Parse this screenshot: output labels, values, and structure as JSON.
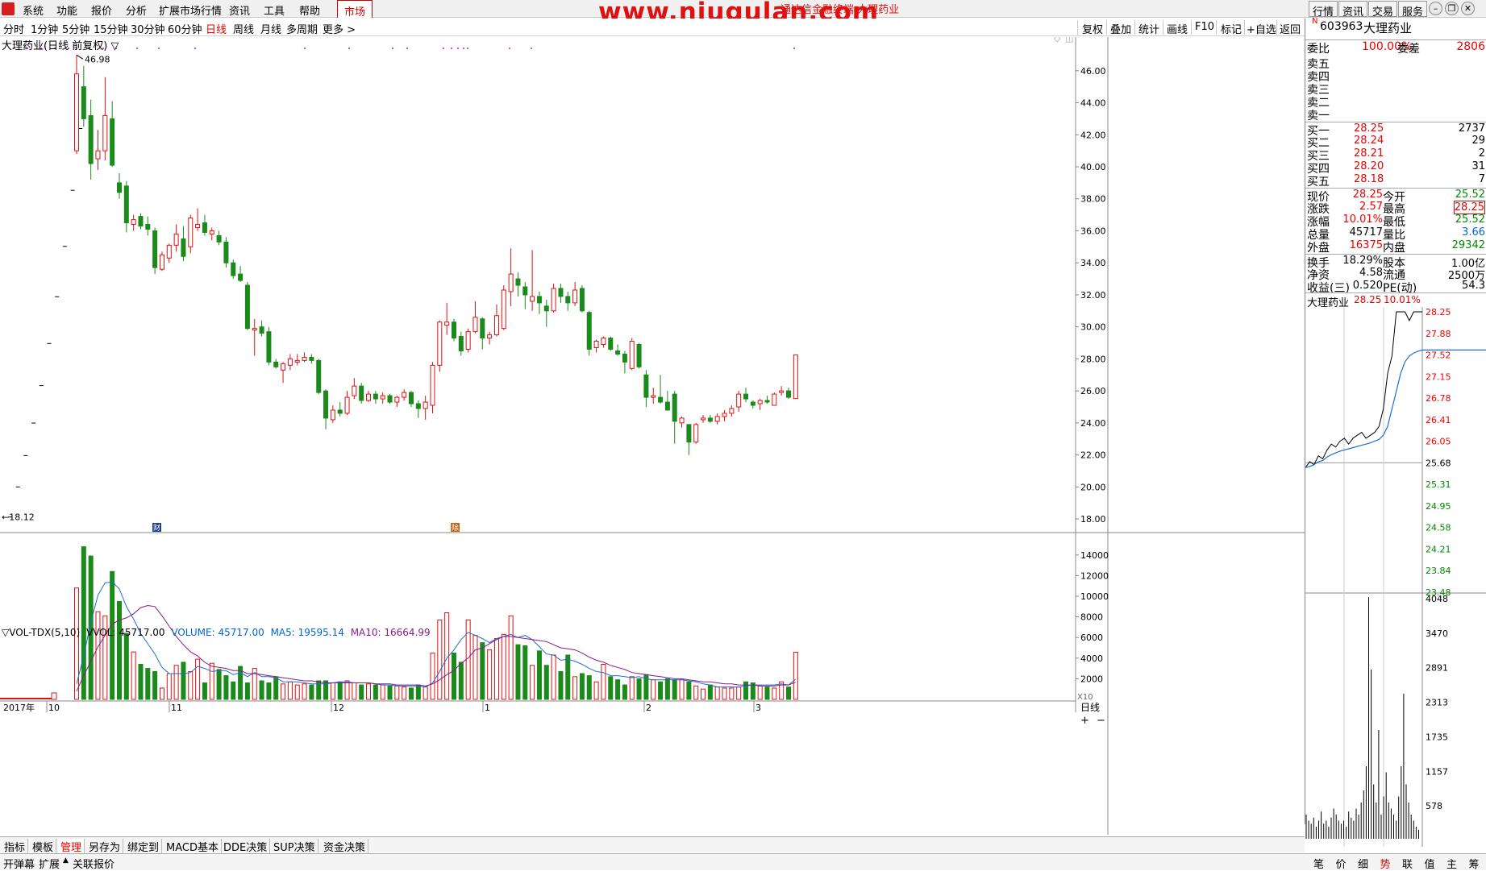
{
  "menu": {
    "items": [
      "系统",
      "功能",
      "报价",
      "分析",
      "扩展市场行情",
      "资讯",
      "工具",
      "帮助"
    ],
    "market": "市场",
    "watermark": "www.niugulan.com",
    "watermark_sub": "通达信金融终端 大理药业",
    "right_buttons": [
      "行情",
      "资讯",
      "交易",
      "服务"
    ]
  },
  "toolbar": {
    "periods": [
      "分时",
      "1分钟",
      "5分钟",
      "15分钟",
      "30分钟",
      "60分钟",
      "日线",
      "周线",
      "月线",
      "多周期",
      "更多 >"
    ],
    "active_period": "日线",
    "tools": [
      "复权",
      "叠加",
      "统计",
      "画线",
      "F10",
      "标记",
      "+自选",
      "返回"
    ]
  },
  "chart": {
    "title": "大理药业(日线 前复权) ▽",
    "high_marker": "46.98",
    "low_marker": "←18.12",
    "price_axis": [
      "46.00",
      "44.00",
      "42.00",
      "40.00",
      "38.00",
      "36.00",
      "34.00",
      "32.00",
      "30.00",
      "28.00",
      "26.00",
      "24.00",
      "22.00",
      "20.00",
      "18.00"
    ],
    "vol_axis": [
      "14000",
      "12000",
      "10000",
      "8000",
      "6000",
      "4000",
      "2000"
    ],
    "vol_unit": "X10",
    "date_labels": [
      "2017年",
      "10",
      "11",
      "12",
      "1",
      "2",
      "3"
    ],
    "period_label": "日线",
    "event_markers": [
      "财",
      "除"
    ],
    "vol_legend": {
      "name": "▽VOL-TDX(5,10)",
      "vvol": "VVOL: 45717.00",
      "volume": "VOLUME: 45717.00",
      "ma5": "MA5: 19595.14",
      "ma10": "MA10: 16664.99"
    },
    "colors": {
      "up": "#e01010",
      "down": "#1a8a1a",
      "ma5": "#1a6fd0",
      "ma10": "#8a1a8a",
      "dot": "#e000e0"
    }
  },
  "chart_data": {
    "type": "candlestick",
    "title": "大理药业(日线 前复权)",
    "ylim": [
      17.5,
      47.5
    ],
    "vol_ylim": [
      0,
      15000
    ],
    "ticks_before": [
      {
        "date": "9-a",
        "price": 18.12
      },
      {
        "date": "9-b",
        "price": 20.0
      },
      {
        "date": "9-c",
        "price": 21.96
      },
      {
        "date": "9-d",
        "price": 23.99
      },
      {
        "date": "9-e",
        "price": 26.33
      },
      {
        "date": "9-f",
        "price": 28.96
      },
      {
        "date": "9-g",
        "price": 31.88
      },
      {
        "date": "9-h",
        "price": 35.03
      },
      {
        "date": "9-i",
        "price": 38.53
      },
      {
        "date": "9-j",
        "price": 42.39
      }
    ],
    "candles": [
      {
        "o": 41.0,
        "h": 46.98,
        "l": 40.8,
        "c": 45.8
      },
      {
        "o": 45.0,
        "h": 46.3,
        "l": 42.5,
        "c": 43.0
      },
      {
        "o": 43.2,
        "h": 44.2,
        "l": 39.2,
        "c": 40.2
      },
      {
        "o": 40.5,
        "h": 42.3,
        "l": 39.8,
        "c": 41.0
      },
      {
        "o": 41.0,
        "h": 45.6,
        "l": 40.4,
        "c": 43.2
      },
      {
        "o": 43.0,
        "h": 44.1,
        "l": 40.0,
        "c": 40.1
      },
      {
        "o": 39.0,
        "h": 39.6,
        "l": 38.0,
        "c": 38.4
      },
      {
        "o": 38.8,
        "h": 39.1,
        "l": 35.9,
        "c": 36.5
      },
      {
        "o": 36.4,
        "h": 37.0,
        "l": 36.0,
        "c": 36.7
      },
      {
        "o": 36.9,
        "h": 37.1,
        "l": 36.1,
        "c": 36.3
      },
      {
        "o": 36.4,
        "h": 36.9,
        "l": 35.7,
        "c": 36.1
      },
      {
        "o": 36.0,
        "h": 36.2,
        "l": 33.3,
        "c": 33.7
      },
      {
        "o": 33.6,
        "h": 34.7,
        "l": 33.5,
        "c": 34.5
      },
      {
        "o": 34.3,
        "h": 35.2,
        "l": 34.0,
        "c": 35.1
      },
      {
        "o": 35.1,
        "h": 36.4,
        "l": 34.7,
        "c": 35.8
      },
      {
        "o": 35.5,
        "h": 36.3,
        "l": 34.1,
        "c": 34.4
      },
      {
        "o": 35.0,
        "h": 37.0,
        "l": 34.6,
        "c": 36.8
      },
      {
        "o": 36.2,
        "h": 37.4,
        "l": 36.0,
        "c": 36.4
      },
      {
        "o": 36.5,
        "h": 37.0,
        "l": 35.7,
        "c": 35.9
      },
      {
        "o": 35.8,
        "h": 36.2,
        "l": 35.4,
        "c": 36.0
      },
      {
        "o": 35.7,
        "h": 36.0,
        "l": 35.1,
        "c": 35.3
      },
      {
        "o": 35.3,
        "h": 35.6,
        "l": 33.7,
        "c": 34.0
      },
      {
        "o": 34.0,
        "h": 34.2,
        "l": 33.0,
        "c": 33.2
      },
      {
        "o": 33.3,
        "h": 33.8,
        "l": 32.8,
        "c": 32.9
      },
      {
        "o": 32.6,
        "h": 32.8,
        "l": 29.8,
        "c": 29.9
      },
      {
        "o": 29.8,
        "h": 30.5,
        "l": 28.2,
        "c": 29.9
      },
      {
        "o": 30.0,
        "h": 30.4,
        "l": 29.4,
        "c": 29.6
      },
      {
        "o": 29.7,
        "h": 30.0,
        "l": 27.6,
        "c": 27.8
      },
      {
        "o": 27.8,
        "h": 28.0,
        "l": 27.4,
        "c": 27.5
      },
      {
        "o": 27.3,
        "h": 27.8,
        "l": 26.5,
        "c": 27.7
      },
      {
        "o": 27.6,
        "h": 28.3,
        "l": 27.3,
        "c": 28.0
      },
      {
        "o": 27.8,
        "h": 28.3,
        "l": 27.6,
        "c": 27.9
      },
      {
        "o": 27.9,
        "h": 28.4,
        "l": 27.8,
        "c": 28.1
      },
      {
        "o": 28.1,
        "h": 28.3,
        "l": 27.7,
        "c": 27.9
      },
      {
        "o": 27.9,
        "h": 28.0,
        "l": 25.8,
        "c": 25.9
      },
      {
        "o": 26.0,
        "h": 26.1,
        "l": 23.6,
        "c": 24.3
      },
      {
        "o": 24.2,
        "h": 25.1,
        "l": 24.0,
        "c": 24.8
      },
      {
        "o": 24.8,
        "h": 25.3,
        "l": 24.4,
        "c": 24.6
      },
      {
        "o": 24.6,
        "h": 26.0,
        "l": 24.5,
        "c": 25.6
      },
      {
        "o": 25.7,
        "h": 26.8,
        "l": 25.5,
        "c": 26.3
      },
      {
        "o": 26.3,
        "h": 26.5,
        "l": 25.2,
        "c": 25.4
      },
      {
        "o": 25.4,
        "h": 26.0,
        "l": 25.3,
        "c": 25.8
      },
      {
        "o": 25.8,
        "h": 26.0,
        "l": 25.2,
        "c": 25.5
      },
      {
        "o": 25.5,
        "h": 25.9,
        "l": 25.2,
        "c": 25.7
      },
      {
        "o": 25.7,
        "h": 25.8,
        "l": 25.2,
        "c": 25.3
      },
      {
        "o": 25.3,
        "h": 25.7,
        "l": 25.0,
        "c": 25.6
      },
      {
        "o": 25.6,
        "h": 26.1,
        "l": 25.4,
        "c": 25.9
      },
      {
        "o": 25.9,
        "h": 26.0,
        "l": 25.0,
        "c": 25.2
      },
      {
        "o": 25.2,
        "h": 25.4,
        "l": 24.3,
        "c": 24.9
      },
      {
        "o": 24.9,
        "h": 25.7,
        "l": 24.2,
        "c": 25.3
      },
      {
        "o": 25.1,
        "h": 27.8,
        "l": 24.6,
        "c": 27.6
      },
      {
        "o": 27.6,
        "h": 30.4,
        "l": 27.2,
        "c": 30.3
      },
      {
        "o": 30.1,
        "h": 31.5,
        "l": 29.5,
        "c": 30.3
      },
      {
        "o": 30.3,
        "h": 30.5,
        "l": 29.1,
        "c": 29.3
      },
      {
        "o": 29.4,
        "h": 29.7,
        "l": 28.2,
        "c": 28.5
      },
      {
        "o": 28.6,
        "h": 29.9,
        "l": 28.4,
        "c": 29.7
      },
      {
        "o": 29.7,
        "h": 31.6,
        "l": 29.6,
        "c": 30.6
      },
      {
        "o": 30.5,
        "h": 30.6,
        "l": 28.6,
        "c": 29.3
      },
      {
        "o": 29.3,
        "h": 29.7,
        "l": 28.9,
        "c": 29.5
      },
      {
        "o": 29.5,
        "h": 31.4,
        "l": 29.4,
        "c": 30.7
      },
      {
        "o": 29.9,
        "h": 32.6,
        "l": 29.8,
        "c": 32.3
      },
      {
        "o": 32.2,
        "h": 34.9,
        "l": 31.3,
        "c": 33.3
      },
      {
        "o": 33.0,
        "h": 33.4,
        "l": 31.9,
        "c": 32.6
      },
      {
        "o": 32.5,
        "h": 32.8,
        "l": 31.1,
        "c": 32.0
      },
      {
        "o": 31.6,
        "h": 34.8,
        "l": 31.0,
        "c": 31.9
      },
      {
        "o": 31.9,
        "h": 32.2,
        "l": 30.8,
        "c": 31.5
      },
      {
        "o": 31.3,
        "h": 31.7,
        "l": 30.0,
        "c": 31.0
      },
      {
        "o": 31.0,
        "h": 32.7,
        "l": 30.9,
        "c": 32.4
      },
      {
        "o": 32.4,
        "h": 32.7,
        "l": 31.5,
        "c": 31.9
      },
      {
        "o": 31.9,
        "h": 32.2,
        "l": 31.0,
        "c": 31.5
      },
      {
        "o": 31.5,
        "h": 32.8,
        "l": 31.3,
        "c": 32.3
      },
      {
        "o": 32.4,
        "h": 32.6,
        "l": 30.9,
        "c": 31.0
      },
      {
        "o": 30.9,
        "h": 31.0,
        "l": 28.2,
        "c": 28.6
      },
      {
        "o": 28.7,
        "h": 29.2,
        "l": 28.4,
        "c": 29.1
      },
      {
        "o": 28.9,
        "h": 29.4,
        "l": 28.7,
        "c": 29.3
      },
      {
        "o": 29.3,
        "h": 29.4,
        "l": 28.5,
        "c": 28.6
      },
      {
        "o": 28.5,
        "h": 28.9,
        "l": 28.2,
        "c": 28.3
      },
      {
        "o": 28.3,
        "h": 28.5,
        "l": 27.1,
        "c": 27.8
      },
      {
        "o": 27.4,
        "h": 29.3,
        "l": 27.3,
        "c": 29.1
      },
      {
        "o": 28.9,
        "h": 29.0,
        "l": 27.4,
        "c": 27.5
      },
      {
        "o": 27.0,
        "h": 27.3,
        "l": 25.0,
        "c": 25.6
      },
      {
        "o": 25.6,
        "h": 26.2,
        "l": 25.2,
        "c": 25.7
      },
      {
        "o": 25.6,
        "h": 27.0,
        "l": 25.2,
        "c": 25.3
      },
      {
        "o": 25.3,
        "h": 26.0,
        "l": 24.8,
        "c": 24.8
      },
      {
        "o": 25.8,
        "h": 26.0,
        "l": 22.7,
        "c": 24.1
      },
      {
        "o": 24.0,
        "h": 24.4,
        "l": 23.7,
        "c": 24.3
      },
      {
        "o": 23.9,
        "h": 23.9,
        "l": 22.0,
        "c": 22.8
      },
      {
        "o": 22.8,
        "h": 24.0,
        "l": 22.7,
        "c": 23.9
      },
      {
        "o": 24.2,
        "h": 24.5,
        "l": 24.0,
        "c": 24.3
      },
      {
        "o": 24.3,
        "h": 24.5,
        "l": 24.0,
        "c": 24.1
      },
      {
        "o": 24.1,
        "h": 24.6,
        "l": 23.9,
        "c": 24.4
      },
      {
        "o": 24.4,
        "h": 24.8,
        "l": 24.1,
        "c": 24.6
      },
      {
        "o": 24.6,
        "h": 25.1,
        "l": 24.4,
        "c": 24.9
      },
      {
        "o": 25.0,
        "h": 26.0,
        "l": 24.7,
        "c": 25.8
      },
      {
        "o": 25.8,
        "h": 26.2,
        "l": 25.3,
        "c": 25.5
      },
      {
        "o": 25.3,
        "h": 25.4,
        "l": 24.9,
        "c": 25.1
      },
      {
        "o": 25.2,
        "h": 25.5,
        "l": 24.8,
        "c": 25.4
      },
      {
        "o": 25.4,
        "h": 25.7,
        "l": 25.2,
        "c": 25.3
      },
      {
        "o": 25.1,
        "h": 25.9,
        "l": 25.1,
        "c": 25.8
      },
      {
        "o": 25.9,
        "h": 26.3,
        "l": 25.7,
        "c": 26.0
      },
      {
        "o": 26.0,
        "h": 26.2,
        "l": 25.5,
        "c": 25.6
      },
      {
        "o": 25.52,
        "h": 28.25,
        "l": 25.52,
        "c": 28.25
      }
    ],
    "volumes": [
      10800,
      14800,
      13900,
      8500,
      8100,
      12400,
      9500,
      6400,
      4600,
      3400,
      3000,
      2700,
      1100,
      2500,
      3300,
      3600,
      2700,
      3900,
      1600,
      3500,
      2900,
      2300,
      1700,
      3200,
      1600,
      3000,
      1800,
      1600,
      2200,
      1500,
      1700,
      1400,
      1500,
      1400,
      1800,
      1800,
      1600,
      1700,
      1800,
      1600,
      1400,
      1500,
      1400,
      1400,
      1300,
      1300,
      1200,
      1100,
      1400,
      1200,
      4500,
      7700,
      8400,
      4500,
      3600,
      7700,
      6200,
      5500,
      4800,
      5900,
      6300,
      8100,
      5300,
      5200,
      3300,
      4700,
      3300,
      4300,
      2700,
      4300,
      2200,
      2500,
      2300,
      1700,
      3400,
      2200,
      1900,
      1400,
      2200,
      2000,
      2400,
      1900,
      1700,
      2000,
      1900,
      1900,
      1700,
      1300,
      1000,
      1400,
      1200,
      1100,
      1100,
      1200,
      1700,
      1600,
      1300,
      1200,
      1100,
      1700,
      1200,
      4571
    ],
    "ma5": [
      1500,
      4200,
      7500,
      10100,
      11300,
      11400,
      10700,
      9000,
      7800,
      6400,
      5400,
      4400,
      3100,
      2500,
      2500,
      2500,
      2600,
      3200,
      3000,
      2700,
      2800,
      2800,
      2400,
      2600,
      2200,
      2600,
      2200,
      2200,
      2100,
      1700,
      1700,
      1700,
      1600,
      1500,
      1500,
      1500,
      1600,
      1700,
      1700,
      1600,
      1600,
      1600,
      1500,
      1400,
      1400,
      1300,
      1300,
      1300,
      1300,
      1200,
      1600,
      2700,
      4000,
      4800,
      5800,
      6500,
      6200,
      5900,
      5500,
      5900,
      6100,
      6300,
      6000,
      6200,
      5800,
      5100,
      4400,
      4300,
      3800,
      3900,
      3700,
      3400,
      3000,
      2700,
      2600,
      2300,
      2300,
      2200,
      2100,
      2200,
      2000,
      1900,
      1900,
      1900,
      1900,
      1900,
      1800,
      1700,
      1500,
      1400,
      1200,
      1200,
      1200,
      1200,
      1300,
      1400,
      1400,
      1400,
      1400,
      1500,
      1400,
      1950
    ],
    "ma10": [
      800,
      2300,
      3700,
      5100,
      6200,
      7300,
      7700,
      7900,
      8300,
      8900,
      9100,
      9000,
      8100,
      7100,
      6100,
      5300,
      4600,
      4200,
      3600,
      3200,
      3100,
      3000,
      2800,
      2800,
      2500,
      2500,
      2400,
      2300,
      2200,
      2100,
      2000,
      1900,
      1800,
      1800,
      1700,
      1600,
      1600,
      1600,
      1600,
      1600,
      1600,
      1600,
      1500,
      1500,
      1500,
      1400,
      1400,
      1400,
      1400,
      1300,
      1500,
      1900,
      2400,
      2800,
      3500,
      4000,
      4800,
      5000,
      5400,
      5800,
      6100,
      6100,
      6000,
      5900,
      5800,
      5700,
      5600,
      5300,
      5000,
      4900,
      4800,
      4500,
      4100,
      3800,
      3600,
      3300,
      3100,
      2900,
      2600,
      2500,
      2400,
      2300,
      2200,
      2100,
      2000,
      2000,
      1900,
      1800,
      1700,
      1700,
      1600,
      1500,
      1500,
      1400,
      1400,
      1400,
      1300,
      1300,
      1300,
      1400,
      1400,
      1666
    ]
  },
  "stock": {
    "code": "603963",
    "name": "大理药业",
    "badge": "N",
    "weibi_label": "委比",
    "weibi": "100.00%",
    "weicha_label": "委差",
    "weicha": "2806",
    "sells": [
      {
        "label": "卖五",
        "price": "",
        "vol": ""
      },
      {
        "label": "卖四",
        "price": "",
        "vol": ""
      },
      {
        "label": "卖三",
        "price": "",
        "vol": ""
      },
      {
        "label": "卖二",
        "price": "",
        "vol": ""
      },
      {
        "label": "卖一",
        "price": "",
        "vol": ""
      }
    ],
    "buys": [
      {
        "label": "买一",
        "price": "28.25",
        "vol": "2737"
      },
      {
        "label": "买二",
        "price": "28.24",
        "vol": "29"
      },
      {
        "label": "买三",
        "price": "28.21",
        "vol": "2"
      },
      {
        "label": "买四",
        "price": "28.20",
        "vol": "31"
      },
      {
        "label": "买五",
        "price": "28.18",
        "vol": "7"
      }
    ],
    "quote": [
      {
        "l1": "现价",
        "v1": "28.25",
        "c1": "red",
        "l2": "今开",
        "v2": "25.52",
        "c2": "green"
      },
      {
        "l1": "涨跌",
        "v1": "2.57",
        "c1": "red",
        "l2": "最高",
        "v2": "28.25",
        "c2": "red"
      },
      {
        "l1": "涨幅",
        "v1": "10.01%",
        "c1": "red",
        "l2": "最低",
        "v2": "25.52",
        "c2": "green"
      },
      {
        "l1": "总量",
        "v1": "45717",
        "c1": "",
        "l2": "量比",
        "v2": "3.66",
        "c2": "blue"
      },
      {
        "l1": "外盘",
        "v1": "16375",
        "c1": "red",
        "l2": "内盘",
        "v2": "29342",
        "c2": "green"
      }
    ],
    "fundamentals": [
      {
        "l1": "换手",
        "v1": "18.29%",
        "l2": "股本",
        "v2": "1.00亿"
      },
      {
        "l1": "净资",
        "v1": "4.58",
        "l2": "流通",
        "v2": "2500万"
      },
      {
        "l1": "收益(三)",
        "v1": "0.520",
        "l2": "PE(动)",
        "v2": "54.3"
      }
    ]
  },
  "mini": {
    "name": "大理药业",
    "price": "28.25",
    "pct": "10.01%",
    "price_axis": [
      "28.25",
      "27.88",
      "27.52",
      "27.15",
      "26.78",
      "26.41",
      "26.05",
      "25.68",
      "25.31",
      "24.95",
      "24.58",
      "24.21",
      "23.84",
      "23.48"
    ],
    "vol_axis": [
      "4048",
      "3470",
      "2891",
      "2313",
      "1735",
      "1157",
      "578"
    ]
  },
  "bottom_tabs": [
    "指标",
    "模板",
    "管理",
    "另存为",
    "绑定到",
    "MACD基本",
    "DDE决策",
    "SUP决策",
    "资金决策"
  ],
  "active_bottom_tab": "管理",
  "status": {
    "left": [
      "开弹幕",
      "扩展",
      "关联报价"
    ],
    "right_tabs": [
      "笔",
      "价",
      "细",
      "势",
      "联",
      "值",
      "主",
      "筹"
    ],
    "active_right_tab": "势"
  }
}
